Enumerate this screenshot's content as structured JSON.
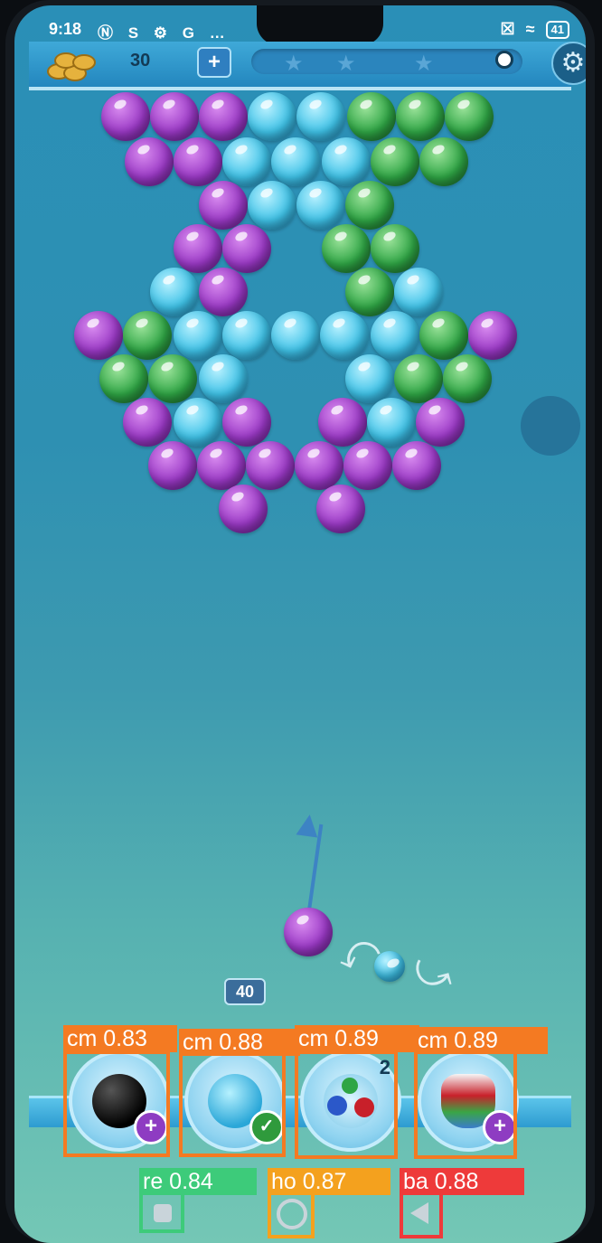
{
  "status_bar": {
    "time": "9:18",
    "left_icons": [
      "nfc-icon",
      "sync-icon",
      "settings-icon",
      "google-icon",
      "more-icon"
    ],
    "left_glyphs": "Ⓝ S ⚙ G …",
    "battery": "41"
  },
  "hud": {
    "coins": "30",
    "add_label": "+",
    "score_marker": "0"
  },
  "game": {
    "moves_left": "40",
    "booster_2_count": "2",
    "colors": {
      "purple": "#9a39c5",
      "cyan": "#3fc2e7",
      "green": "#2fa545"
    },
    "bubble_rows": [
      [
        "P",
        "P",
        "P",
        "C",
        "C",
        "G",
        "G",
        "G"
      ],
      [
        "P",
        "P",
        "C",
        "C",
        "C",
        "G",
        "G"
      ],
      [
        "P",
        "C",
        "C",
        "G"
      ],
      [
        "P",
        "P",
        "G",
        "G"
      ],
      [
        "C",
        "P",
        "G",
        "C"
      ],
      [
        "P",
        "G",
        "C",
        "C",
        "C",
        "C",
        "C",
        "G",
        "P"
      ],
      [
        "G",
        "G",
        "C",
        "C",
        "G",
        "G"
      ],
      [
        "P",
        "C",
        "P",
        "P",
        "C",
        "P"
      ],
      [
        "P",
        "P",
        "P",
        "P",
        "P",
        "P"
      ],
      [
        "P",
        "P"
      ]
    ]
  },
  "detections": [
    {
      "label": "cm 0.83",
      "color": "#f47a22"
    },
    {
      "label": "cm 0.88",
      "color": "#f47a22"
    },
    {
      "label": "cm 0.89",
      "color": "#f47a22"
    },
    {
      "label": "cm 0.89",
      "color": "#f47a22"
    },
    {
      "label": "re 0.84",
      "color": "#3dcb7a"
    },
    {
      "label": "ho 0.87",
      "color": "#f4a11e"
    },
    {
      "label": "ba 0.88",
      "color": "#ee3a3a"
    }
  ]
}
